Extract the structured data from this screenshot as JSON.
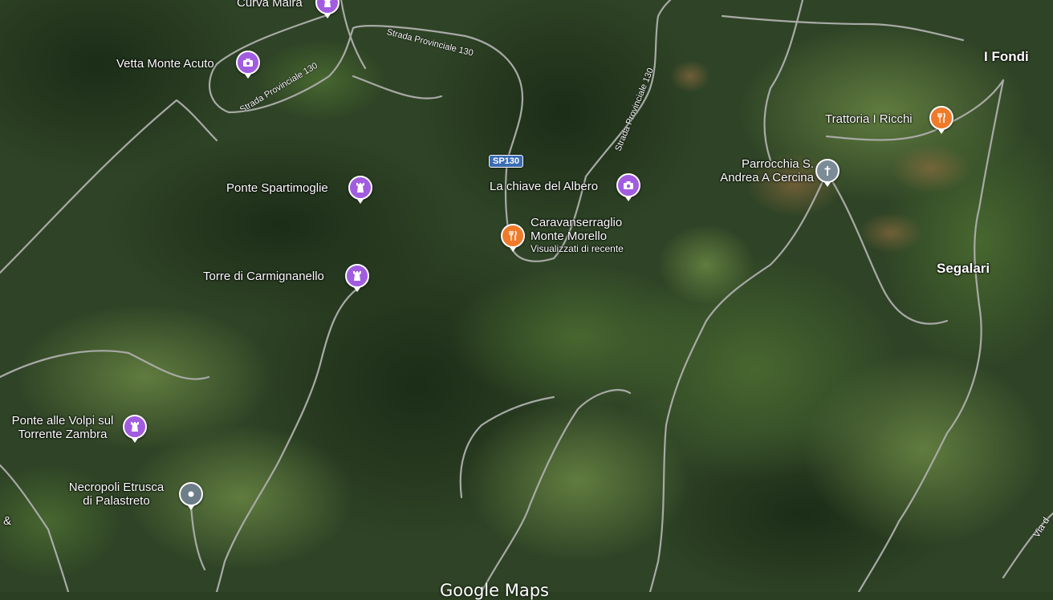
{
  "colors": {
    "attraction": "#a25ce0",
    "restaurant": "#ef7a2a",
    "church": "#7c8c96",
    "landmark": "#6e7e88",
    "road": "#a8aaa6",
    "shield": "#3b6db3"
  },
  "pois": {
    "curva_maira": {
      "label": "Curva Maira",
      "icon": "tower-icon"
    },
    "vetta_monte_acuto": {
      "label": "Vetta Monte Acuto",
      "icon": "camera-icon"
    },
    "ponte_spartimoglie": {
      "label": "Ponte Spartimoglie",
      "icon": "tower-icon"
    },
    "torre_carmignanello": {
      "label": "Torre di Carmignanello",
      "icon": "tower-icon"
    },
    "chiave_albero": {
      "label": "La chiave del Albero",
      "icon": "camera-icon"
    },
    "caravanserraglio": {
      "label_line1": "Caravanserraglio",
      "label_line2": "Monte Morello",
      "sublabel": "Visualizzati di recente",
      "icon": "fork-knife-icon"
    },
    "trattoria_ricchi": {
      "label": "Trattoria I Ricchi",
      "icon": "fork-knife-icon"
    },
    "parrocchia": {
      "label_line1": "Parrocchia S.",
      "label_line2": "Andrea A Cercina",
      "icon": "cross-icon"
    },
    "ponte_volpi": {
      "label_line1": "Ponte alle Volpi sul",
      "label_line2": "Torrente Zambra",
      "icon": "tower-icon"
    },
    "necropoli": {
      "label_line1": "Necropoli Etrusca",
      "label_line2": "di Palastreto",
      "icon": "dot-icon"
    }
  },
  "places": {
    "i_fondi": "I Fondi",
    "segalari": "Segalari"
  },
  "roads": {
    "sp130_a": "Strada Provinciale 130",
    "sp130_b": "Strada Provinciale 130",
    "sp130_c": "Strada Provinciale 130",
    "shield": "SP130",
    "via_partial": "Via d",
    "edge_partial": "&"
  },
  "logo": "Google Maps"
}
